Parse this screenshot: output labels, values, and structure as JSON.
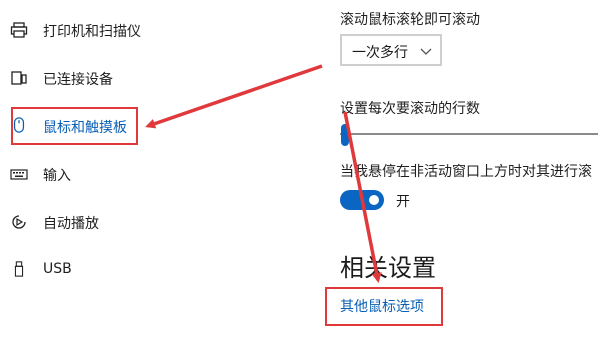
{
  "sidebar": {
    "items": [
      {
        "label": "打印机和扫描仪",
        "icon": "printer-icon"
      },
      {
        "label": "已连接设备",
        "icon": "connected-devices-icon"
      },
      {
        "label": "鼠标和触摸板",
        "icon": "mouse-icon",
        "selected": true
      },
      {
        "label": "输入",
        "icon": "keyboard-icon"
      },
      {
        "label": "自动播放",
        "icon": "autoplay-icon"
      },
      {
        "label": "USB",
        "icon": "usb-icon"
      }
    ]
  },
  "main": {
    "scroll_wheel_label": "滚动鼠标滚轮即可滚动",
    "scroll_dropdown_value": "一次多行",
    "lines_to_scroll_label": "设置每次要滚动的行数",
    "inactive_scroll_label": "当我悬停在非活动窗口上方时对其进行滚",
    "inactive_scroll_toggle_state": "开",
    "related_heading": "相关设置",
    "other_mouse_options_link": "其他鼠标选项"
  },
  "colors": {
    "accent": "#0a66c2",
    "link": "#0a5fb4",
    "annotation_red": "#e0393b"
  }
}
